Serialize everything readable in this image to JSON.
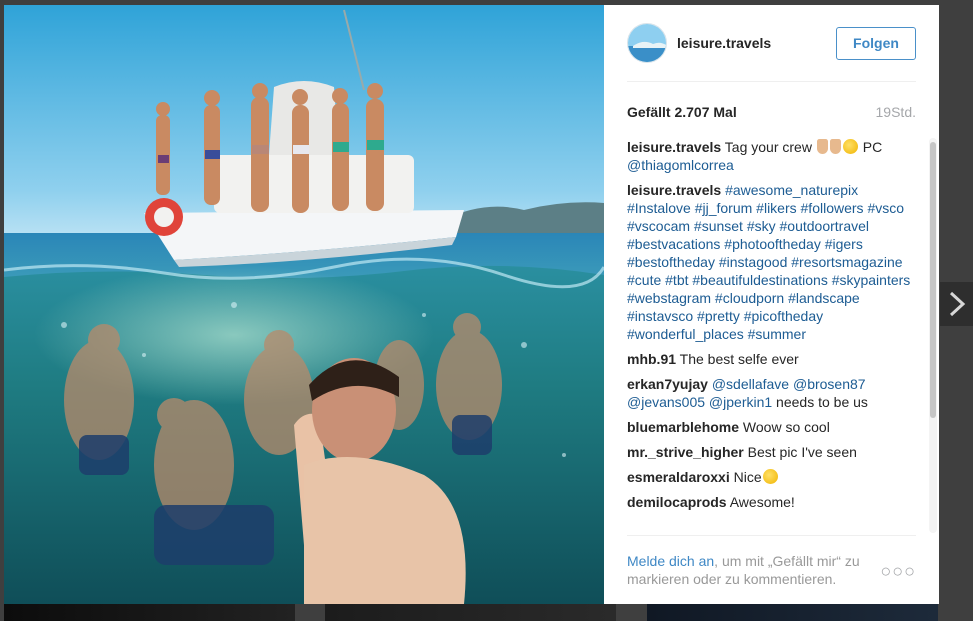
{
  "post": {
    "username": "leisure.travels",
    "follow_label": "Folgen",
    "likes": "Gefällt 2.707 Mal",
    "time": "19Std."
  },
  "comments": [
    {
      "author": "leisure.travels",
      "parts": [
        {
          "t": "text",
          "v": " Tag your crew "
        },
        {
          "t": "emoji",
          "v": "hand"
        },
        {
          "t": "emoji",
          "v": "hand"
        },
        {
          "t": "emoji",
          "v": "face"
        },
        {
          "t": "text",
          "v": " PC "
        },
        {
          "t": "link",
          "v": "@thiagomlcorrea"
        }
      ]
    },
    {
      "author": "leisure.travels",
      "parts": [
        {
          "t": "text",
          "v": " "
        },
        {
          "t": "link",
          "v": "#awesome_naturepix #Instalove #jj_forum #likers #followers #vsco #vscocam #sunset #sky #outdoortravel #bestvacations #photooftheday #igers #bestoftheday #instagood #resortsmagazine #cute #tbt #beautifuldestinations #skypainters #webstagram #cloudporn #landscape #instavsco #pretty #picoftheday #wonderful_places #summer"
        }
      ]
    },
    {
      "author": "mhb.91",
      "parts": [
        {
          "t": "text",
          "v": " The best selfe ever"
        }
      ]
    },
    {
      "author": "erkan7yujay",
      "parts": [
        {
          "t": "text",
          "v": " "
        },
        {
          "t": "link",
          "v": "@sdellafave @brosen87 @jevans005 @jperkin1"
        },
        {
          "t": "text",
          "v": " needs to be us"
        }
      ]
    },
    {
      "author": "bluemarblehome",
      "parts": [
        {
          "t": "text",
          "v": " Woow so cool"
        }
      ]
    },
    {
      "author": "mr._strive_higher",
      "parts": [
        {
          "t": "text",
          "v": " Best pic I've seen"
        }
      ]
    },
    {
      "author": "esmeraldaroxxi",
      "parts": [
        {
          "t": "text",
          "v": " Nice"
        },
        {
          "t": "emoji",
          "v": "face"
        }
      ]
    },
    {
      "author": "demilocaprods",
      "parts": [
        {
          "t": "text",
          "v": " Awesome!"
        }
      ]
    }
  ],
  "footer": {
    "login_link": "Melde dich an",
    "rest": ", um mit „Gefällt mir“ zu markieren oder zu kommentieren.",
    "more": "○○○"
  },
  "icons": {
    "next": "chevron-right-icon",
    "more": "more-options-icon"
  },
  "colors": {
    "accent": "#3f88c5",
    "link": "#1d5c93",
    "muted": "#a5a7aa"
  }
}
